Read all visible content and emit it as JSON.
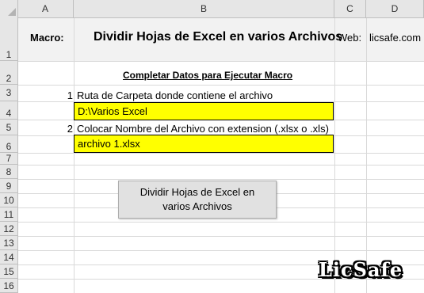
{
  "columns": [
    "A",
    "B",
    "C",
    "D"
  ],
  "rows": [
    "1",
    "2",
    "3",
    "4",
    "5",
    "6",
    "7",
    "8",
    "9",
    "10",
    "11",
    "12",
    "13",
    "14",
    "15",
    "16"
  ],
  "header": {
    "macro_label": "Macro:",
    "title": "Dividir Hojas de Excel en varios Archivos",
    "web_label": "Web:",
    "web_value": "licsafe.com"
  },
  "section": {
    "title": "Completar Datos para Ejecutar Macro"
  },
  "steps": [
    {
      "num": "1",
      "label": "Ruta de Carpeta donde contiene el archivo",
      "value": "D:\\Varios Excel"
    },
    {
      "num": "2",
      "label": "Colocar Nombre del Archivo con extension (.xlsx o .xls)",
      "value": "archivo 1.xlsx"
    }
  ],
  "button": {
    "label": "Dividir Hojas de Excel en varios Archivos"
  },
  "watermark": "LicSafe",
  "colors": {
    "input_fill": "#ffff00",
    "header_bg": "#e6e6e6",
    "gridline": "#d9d9d9"
  }
}
